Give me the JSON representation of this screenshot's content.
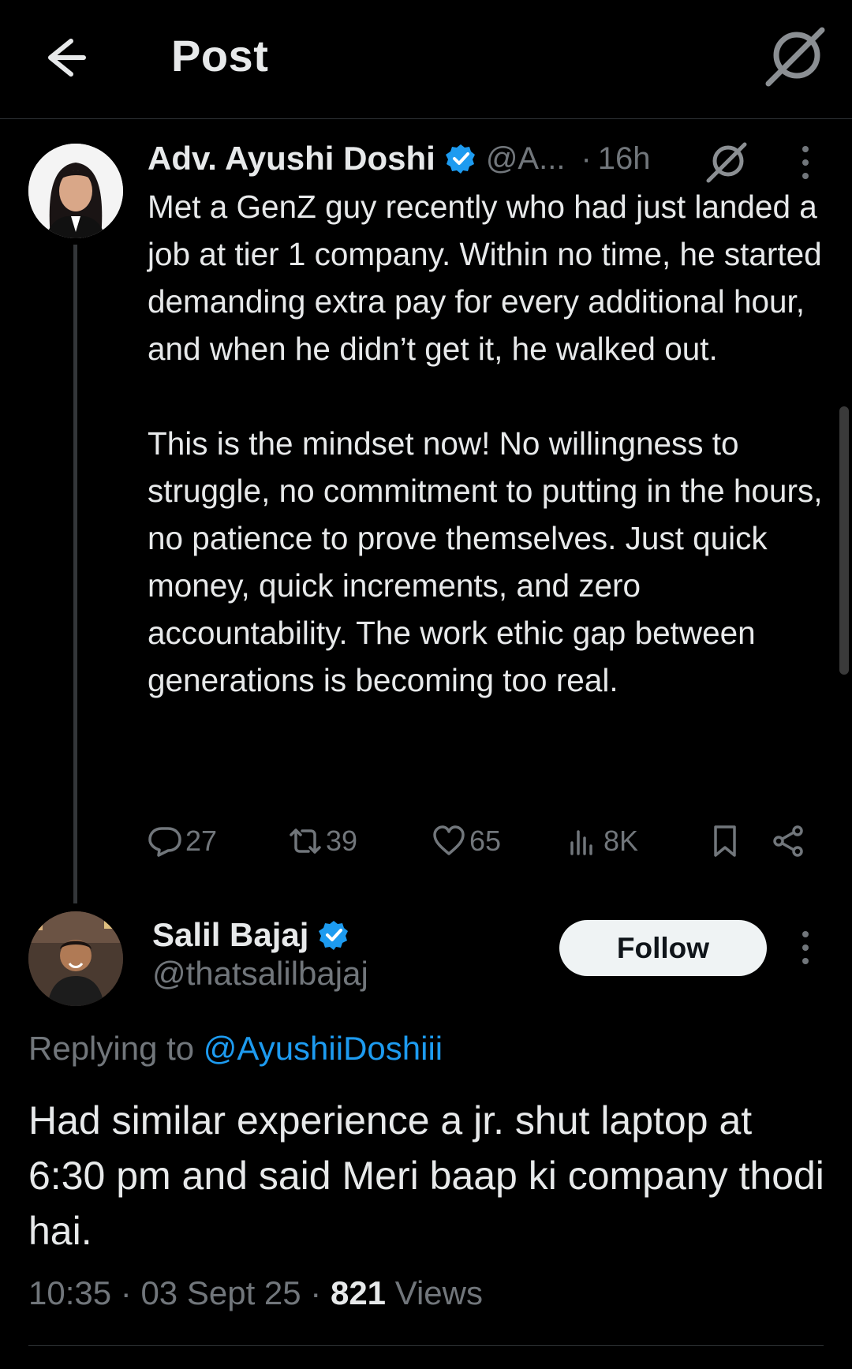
{
  "header": {
    "title": "Post"
  },
  "tweet": {
    "author_name": "Adv. Ayushi Doshi",
    "author_handle": "@A...",
    "separator": "·",
    "time": "16h",
    "text": "Met a GenZ guy recently who had just landed a job at tier 1 company. Within no time, he started demanding extra pay for every additional hour, and when he didn’t get it, he walked out.\n\nThis is the mindset now! No willingness to struggle, no commitment to putting in the hours, no patience to prove themselves. Just quick money, quick increments, and zero accountability. The work ethic gap between generations is becoming too real.",
    "replies": "27",
    "reposts": "39",
    "likes": "65",
    "views": "8K"
  },
  "reply": {
    "author_name": "Salil Bajaj",
    "author_handle": "@thatsalilbajaj",
    "follow_label": "Follow",
    "replying_to_label": "Replying to",
    "replying_to_handle": "@AyushiiDoshiii",
    "text": "Had similar experience a jr. shut laptop at 6:30 pm and said Meri baap ki company thodi hai.",
    "time": "10:35",
    "date": "03 Sept 25",
    "meta_sep": "·",
    "views_count": "821",
    "views_label": "Views"
  },
  "icons": {
    "back": "arrow-left-icon",
    "grok": "grok-icon",
    "verified": "verified-badge-icon",
    "more": "more-vertical-icon",
    "reply": "reply-bubble-icon",
    "repost": "repost-icon",
    "like": "heart-icon",
    "views": "analytics-icon",
    "bookmark": "bookmark-icon",
    "share": "share-icon"
  },
  "colors": {
    "background": "#000000",
    "text_primary": "#e7e9ea",
    "text_secondary": "#71767b",
    "accent_blue": "#1d9bf0",
    "follow_bg": "#eff3f4"
  }
}
